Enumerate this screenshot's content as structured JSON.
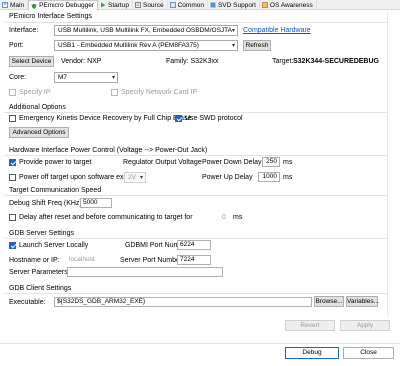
{
  "tabs": [
    {
      "label": "Main",
      "icon": "main-icon",
      "color": "#3a7bd5"
    },
    {
      "label": "PEmicro Debugger",
      "icon": "debugger-icon",
      "color": "#3a9a3a",
      "active": true
    },
    {
      "label": "Startup",
      "icon": "startup-icon",
      "color": "#3aa64a"
    },
    {
      "label": "Source",
      "icon": "source-icon",
      "color": "#6b6b6b"
    },
    {
      "label": "Common",
      "icon": "common-icon",
      "color": "#5b79b8"
    },
    {
      "label": "SVD Support",
      "icon": "svd-icon",
      "color": "#5c8fd6"
    },
    {
      "label": "OS Awareness",
      "icon": "os-icon",
      "color": "#c07a1a"
    }
  ],
  "interface_settings": {
    "title": "PEmicro Interface Settings",
    "interface_label": "Interface:",
    "interface_value": "USB Multilink, USB Multilink FX, Embedded OSBDM/OSJTA",
    "compatible_link": "Compatible Hardware",
    "port_label": "Port:",
    "port_value": "USB1 - Embedded Multilink Rev A (PEM8FA375)",
    "refresh": "Refresh",
    "select_device": "Select Device",
    "vendor": "Vendor: NXP",
    "family": "Family: S32K3xx",
    "target_label": "Target:",
    "target_value": "S32K344-SECUREDEBUG",
    "core_label": "Core:",
    "core_value": "M7",
    "specify_ip": "Specify IP",
    "specify_network": "Specify Network Card IP"
  },
  "additional": {
    "title": "Additional Options",
    "kinetis": "Emergency Kinetis Device Recovery by Full Chip Erase",
    "swd": "Use SWD protocol",
    "advanced": "Advanced Options"
  },
  "power": {
    "title": "Hardware Interface Power Control (Voltage --> Power-Out Jack)",
    "provide": "Provide power to target",
    "regulator": "Regulator Output Voltage",
    "down_delay_label": "Power Down Delay",
    "down_delay_value": "250",
    "ms": "ms",
    "power_off": "Power off target upon software exit",
    "voltage": "2V",
    "up_delay_label": "Power Up Delay",
    "up_delay_value": "1000"
  },
  "comm": {
    "title": "Target Communication Speed",
    "shift_label": "Debug Shift Freq (KHz)",
    "shift_value": "5000",
    "delay_label": "Delay after reset and before communicating to target for",
    "delay_value": "0",
    "ms": "ms"
  },
  "gdb_server": {
    "title": "GDB Server Settings",
    "launch": "Launch Server Locally",
    "gdbmi_label": "GDBMI Port Number:",
    "gdbmi_value": "6224",
    "host_label": "Hostname or IP:",
    "host_value": "localhost",
    "server_port_label": "Server Port Number:",
    "server_port_value": "7224",
    "params_label": "Server Parameters:",
    "params_value": ""
  },
  "gdb_client": {
    "title": "GDB Client Settings",
    "exec_label": "Executable:",
    "exec_value": "${S32DS_GDB_ARM32_EXE}",
    "browse": "Browse...",
    "variables": "Variables..."
  },
  "actions": {
    "revert": "Revert",
    "apply": "Apply",
    "debug": "Debug",
    "close": "Close"
  },
  "colors": {
    "accent": "#1e63c9",
    "link": "#0b57c9"
  }
}
